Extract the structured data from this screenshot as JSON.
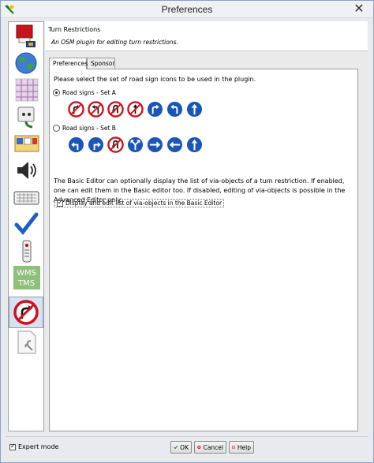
{
  "window": {
    "title": "Preferences"
  },
  "sidebar": {
    "items": [
      {
        "icon": "display-settings-icon"
      },
      {
        "icon": "globe-icon"
      },
      {
        "icon": "map-paint-icon"
      },
      {
        "icon": "connection-plug-icon"
      },
      {
        "icon": "toolbar-icon"
      },
      {
        "icon": "audio-speaker-icon"
      },
      {
        "icon": "keyboard-icon"
      },
      {
        "icon": "validator-checkmark-icon"
      },
      {
        "icon": "remote-control-icon"
      },
      {
        "icon": "wms-tms-icon",
        "label_top": "WMS",
        "label_bottom": "TMS"
      },
      {
        "icon": "turn-restriction-icon",
        "selected": true
      },
      {
        "icon": "plugin-settings-icon"
      }
    ]
  },
  "header": {
    "title": "Turn Restrictions",
    "description": "An OSM plugin for editing turn restrictions."
  },
  "tabs": [
    {
      "label": "Preferences",
      "active": true
    },
    {
      "label": "Sponsor",
      "active": false
    }
  ],
  "prefs": {
    "instruction": "Please select the set of road sign icons to be used in the plugin.",
    "set_a_label": "Road signs - Set A",
    "set_b_label": "Road signs - Set B",
    "set_a_selected": true,
    "description": "The Basic Editor can optionally display the list of via-objects of a turn restriction. If enabled, one can edit them in the Basic editor too. If disabled, editing of via-objects is possible in the Advanced Editor only.",
    "checkbox_label": "Display and edit list of via-objects in the Basic Editor",
    "checkbox_checked": true
  },
  "footer": {
    "expert_mode_label": "Expert mode",
    "expert_mode_checked": true,
    "ok_label": "OK",
    "cancel_label": "Cancel",
    "help_label": "Help"
  },
  "colors": {
    "sign_red": "#d0101c",
    "sign_blue": "#1a56b8"
  }
}
